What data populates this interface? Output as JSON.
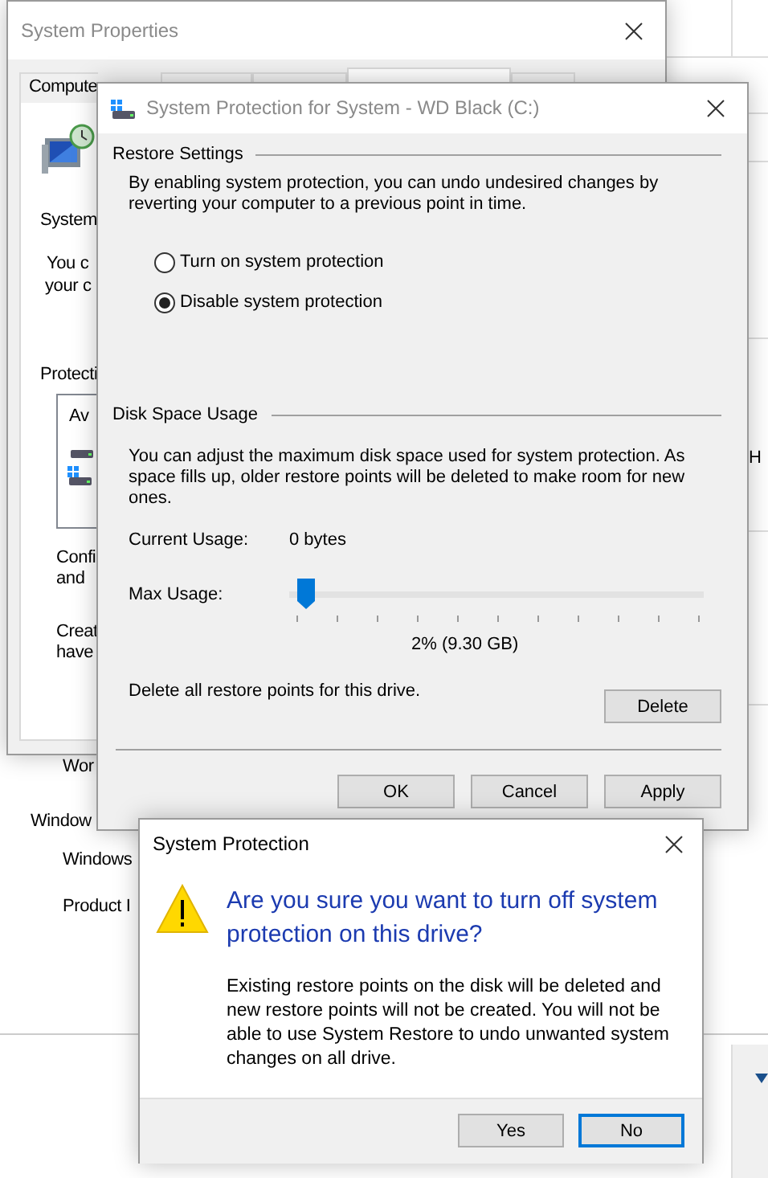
{
  "background_window": {
    "title": "System Properties",
    "tabs": [
      {
        "label": "Compute",
        "selected": false
      },
      {
        "selected": false
      },
      {
        "selected": false
      },
      {
        "selected": true
      },
      {
        "selected": false
      }
    ],
    "texts": [
      "System",
      "You c",
      "your c",
      "Protecti",
      "Av",
      "Confi",
      "and",
      "Creat",
      "have"
    ]
  },
  "lower_window": {
    "texts": [
      "Wor",
      "Window",
      "Windows",
      "Product I"
    ]
  },
  "right_window": {
    "texts": [
      "H"
    ]
  },
  "protection_dialog": {
    "title": "System Protection for System - WD Black (C:)",
    "restore_settings": {
      "heading": "Restore Settings",
      "description": "By enabling system protection, you can undo undesired changes by reverting your computer to a previous point in time.",
      "options": [
        {
          "label": "Turn on system protection",
          "selected": false
        },
        {
          "label": "Disable system protection",
          "selected": true
        }
      ]
    },
    "disk_space": {
      "heading": "Disk Space Usage",
      "description": "You can adjust the maximum disk space used for system protection. As space fills up, older restore points will be deleted to make room for new ones.",
      "current_usage_label": "Current Usage:",
      "current_usage": "0 bytes",
      "max_usage_label": "Max Usage:",
      "max_usage": {
        "level": 0.02
      },
      "max_usage_reading": "2% (9.30 GB)",
      "delete_text": "Delete all restore points for this drive.",
      "delete_button": "Delete"
    },
    "buttons": [
      "OK",
      "Cancel",
      "Apply"
    ]
  },
  "confirm_dialog": {
    "title": "System Protection",
    "question": "Are you sure you want to turn off system protection on this drive?",
    "message": "Existing restore points on the disk will be deleted and new restore points will not be created. You will not be able to use System Restore to undo unwanted system changes on all drive.",
    "buttons": [
      {
        "label": "Yes",
        "default": false
      },
      {
        "label": "No",
        "default": true
      }
    ]
  }
}
